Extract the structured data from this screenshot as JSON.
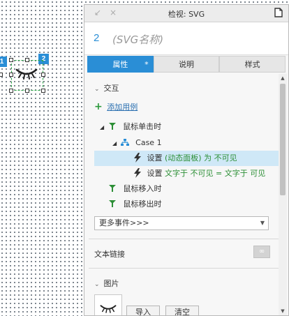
{
  "canvas": {
    "badge_left": "1",
    "badge_right": "2"
  },
  "panel": {
    "title": "检视: SVG",
    "back_glyph": "↙",
    "close_glyph": "×",
    "widget_index": "2",
    "widget_name": "(SVG名称)",
    "tabs": [
      {
        "label": "属性",
        "marker": "*"
      },
      {
        "label": "说明"
      },
      {
        "label": "样式"
      }
    ],
    "interaction": {
      "section_label": "交互",
      "add_case_label": "添加用例",
      "events": [
        {
          "label": "鼠标单击时"
        },
        {
          "label": "鼠标移入时"
        },
        {
          "label": "鼠标移出时"
        }
      ],
      "case_label": "Case 1",
      "actions": [
        {
          "prefix": "设置",
          "detail": "(动态面板) 为 不可见"
        },
        {
          "prefix": "设置",
          "detail": "文字于 不可见 = 文字于 可见"
        }
      ],
      "more_events_label": "更多事件>>>"
    },
    "text_link_label": "文本链接",
    "image": {
      "section_label": "图片",
      "import_label": "导入",
      "clear_label": "清空"
    }
  },
  "icons": [
    "closed-eye-icon",
    "document-icon",
    "add-icon",
    "interaction-flag-icon",
    "case-tree-icon",
    "lightning-icon",
    "link-icon",
    "chevron-down-icon",
    "dropdown-arrow-icon"
  ],
  "colors": {
    "accent": "#2a8ed6",
    "selection_green": "#2ea84a",
    "highlight_row": "#cfe8f7",
    "action_green": "#2c8f36"
  }
}
